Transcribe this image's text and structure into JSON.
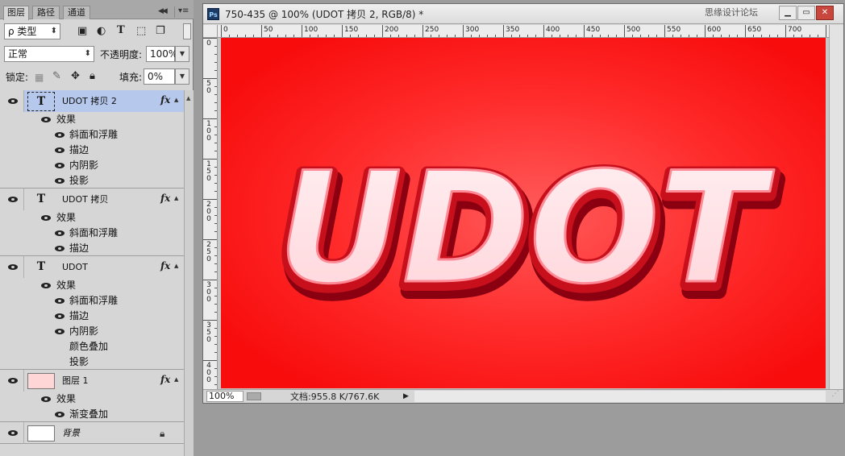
{
  "panel": {
    "tabs": [
      {
        "label": "图层",
        "active": true
      },
      {
        "label": "路径",
        "active": false
      },
      {
        "label": "通道",
        "active": false
      }
    ],
    "filter_label": "ρ 类型",
    "filter_icons": [
      "image-filter-icon",
      "adjustment-filter-icon",
      "type-filter-icon",
      "shape-filter-icon",
      "smart-object-filter-icon",
      "filter-toggle-icon"
    ],
    "blend_mode": "正常",
    "opacity_label": "不透明度:",
    "opacity_value": "100%",
    "lock_label": "锁定:",
    "lock_icons": [
      "lock-transparent-icon",
      "lock-image-icon",
      "lock-position-icon",
      "lock-all-icon"
    ],
    "fill_label": "填充:",
    "fill_value": "0%"
  },
  "layers": [
    {
      "name": "UDOT 拷贝 2",
      "kind": "text",
      "thumb": "T",
      "selected": true,
      "fx": "fx",
      "effects_label": "效果",
      "effects": [
        "斜面和浮雕",
        "描边",
        "内阴影",
        "投影"
      ]
    },
    {
      "name": "UDOT 拷贝",
      "kind": "text",
      "thumb": "T",
      "selected": false,
      "fx": "fx",
      "effects_label": "效果",
      "effects": [
        "斜面和浮雕",
        "描边"
      ]
    },
    {
      "name": "UDOT",
      "kind": "text",
      "thumb": "T",
      "selected": false,
      "fx": "fx",
      "effects_label": "效果",
      "effects": [
        "斜面和浮雕",
        "描边",
        "内阴影",
        "颜色叠加",
        "投影"
      ]
    },
    {
      "name": "图层 1",
      "kind": "pixel",
      "selected": false,
      "fx": "fx",
      "thumb_color": "#ffd6d6",
      "effects_label": "效果",
      "effects": [
        "渐变叠加"
      ]
    },
    {
      "name": "背景",
      "kind": "background",
      "selected": false,
      "thumb_color": "#ffffff"
    }
  ],
  "document": {
    "app_icon": "Ps",
    "title": "750-435 @ 100% (UDOT 拷贝 2, RGB/8) *",
    "watermark": "思缘设计论坛",
    "window_buttons": [
      "minimize-icon",
      "maximize-icon",
      "close-icon"
    ],
    "canvas_text": "UDOT",
    "zoom": "100%",
    "doc_info": "文档:955.8 K/767.6K",
    "ruler_top_labels": [
      "0",
      "50",
      "100",
      "150",
      "200",
      "250",
      "300",
      "350",
      "400",
      "450",
      "500",
      "550",
      "600",
      "650",
      "700"
    ],
    "ruler_left_labels": [
      "0",
      "50",
      "100",
      "150",
      "200",
      "250",
      "300",
      "350",
      "400"
    ]
  },
  "colors": {
    "selected_row": "#b6c8ec",
    "canvas_red": "#ff1a1a",
    "canvas_glow": "#ff5a5a",
    "text_fill": "#ffe4e8",
    "text_stroke": "#b40010"
  }
}
